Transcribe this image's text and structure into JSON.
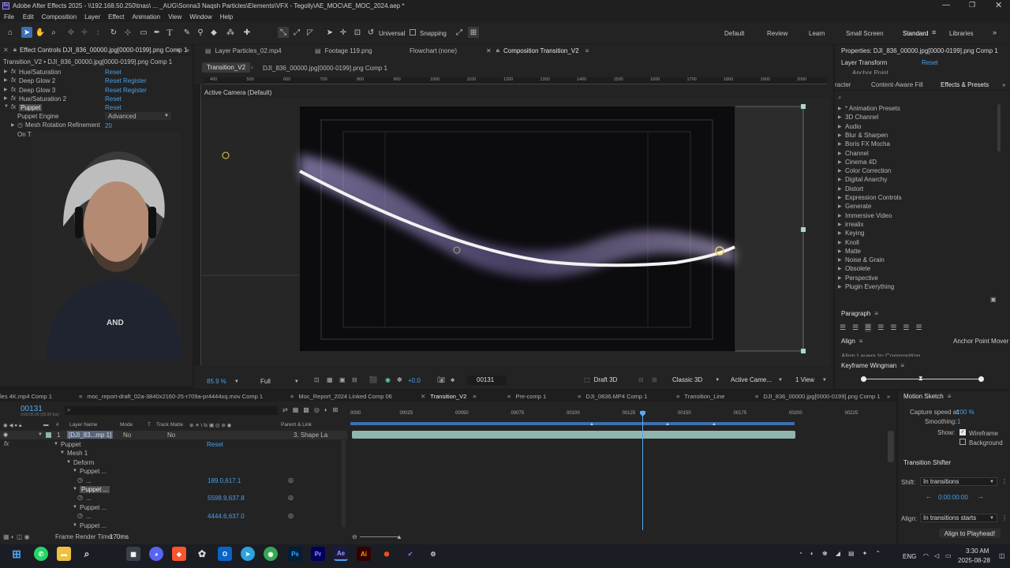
{
  "app": {
    "title": "Adobe After Effects 2025 - \\\\192.168.50.250\\tnas\\ ... _AUG\\Sonna3 Naqsh Particles\\Elements\\VFX - Tegolly\\AE_MOC\\AE_MOC_2024.aep *",
    "menu": [
      "File",
      "Edit",
      "Composition",
      "Layer",
      "Effect",
      "Animation",
      "View",
      "Window",
      "Help"
    ]
  },
  "toolbar": {
    "universal": "Universal",
    "snapping": "Snapping",
    "workspaces": [
      "Default",
      "Review",
      "Learn",
      "Small Screen",
      "Standard",
      "Libraries"
    ]
  },
  "effect_controls": {
    "tab": "Effect Controls DJI_836_00000.jpg[0000-0199].png Comp 1",
    "subtitle": "Transition_V2 • DJI_836_00000.jpg[0000-0199].png Comp 1",
    "effects": [
      {
        "name": "Hue/Saturation",
        "reset": "Reset",
        "register": ""
      },
      {
        "name": "Deep Glow 2",
        "reset": "Reset",
        "register": "Register"
      },
      {
        "name": "Deep Glow 3",
        "reset": "Reset",
        "register": "Register"
      },
      {
        "name": "Hue/Saturation 2",
        "reset": "Reset",
        "register": ""
      },
      {
        "name": "Puppet",
        "reset": "Reset",
        "register": ""
      }
    ],
    "puppet_engine_label": "Puppet Engine",
    "puppet_engine_value": "Advanced",
    "mesh_rotation_label": "Mesh Rotation Refinement",
    "mesh_rotation_value": "20",
    "on_transparent_label": "On Transparent"
  },
  "comp_panel": {
    "tabs": [
      "Layer Particles_02.mp4",
      "Footage 119.png",
      "Flowchart (none)",
      "Composition Transition_V2"
    ],
    "subtabs": [
      "Transition_V2",
      "DJI_836_00000.jpg[0000-0199].png Comp 1"
    ],
    "ruler": [
      "400",
      "500",
      "600",
      "700",
      "800",
      "900",
      "1000",
      "1100",
      "1200",
      "1300",
      "1400",
      "1500",
      "1600",
      "1700",
      "1800",
      "1900",
      "2000"
    ],
    "camera_label": "Active Camera (Default)",
    "zoom": "85.9 %",
    "resolution": "Full",
    "exposure": "+0.0",
    "timecode": "00131",
    "renderer_draft": "Draft 3D",
    "renderer": "Classic 3D",
    "camera_select": "Active Came...",
    "view_select": "1 View"
  },
  "properties": {
    "title": "Properties: DJI_836_00000.jpg[0000-0199].png Comp 1",
    "layer_transform": "Layer Transform",
    "reset": "Reset",
    "anchor": "Anchor Point"
  },
  "effects_presets": {
    "tabs": [
      "racter",
      "Content-Aware Fill",
      "Effects & Presets"
    ],
    "items": [
      "* Animation Presets",
      "3D Channel",
      "Audio",
      "Blur & Sharpen",
      "Boris FX Mocha",
      "Channel",
      "Cinema 4D",
      "Color Correction",
      "Digital Anarchy",
      "Distort",
      "Expression Controls",
      "Generate",
      "Immersive Video",
      "irrealix",
      "Keying",
      "Knoll",
      "Matte",
      "Noise & Grain",
      "Obsolete",
      "Perspective",
      "Plugin Everything"
    ]
  },
  "paragraph": {
    "title": "Paragraph"
  },
  "align": {
    "title": "Align",
    "anchor_mover": "Anchor Point Mover",
    "align_layers_to": "Align Layers to:",
    "composition": "Composition"
  },
  "keyframe_wingman": {
    "title": "Keyframe Wingman"
  },
  "motion_sketch": {
    "title": "Motion Sketch",
    "capture_label": "Capture speed at:",
    "capture_value": "100 %",
    "smoothing_label": "Smoothing:",
    "smoothing_value": "1",
    "show_label": "Show:",
    "wireframe": "Wireframe",
    "background": "Background"
  },
  "transition_shifter": {
    "title": "Transition Shifter",
    "shift_label": "Shift:",
    "shift_value": "In transitions",
    "time_value": "0:00:00:00",
    "align_label": "Align:",
    "align_value": "In transitions starts",
    "playhead_button": "Align to Playhead!"
  },
  "timeline": {
    "tabs": [
      "les 4K.mp4 Comp 1",
      "moc_report-draft_02a-3840x2160-25-r709a-pr4444xq.mov Comp 1",
      "Moc_Report_2024 Linked Comp 06",
      "Transition_V2",
      "Pre-comp 1",
      "DJI_0836.MP4 Comp 1",
      "Transition_Line",
      "DJI_836_00000.jpg[0000-0199].png Comp 1"
    ],
    "timecode": "00131",
    "timecode_sub": "0:00:05:06 (25.00 fps)",
    "col_headers": {
      "layer_name": "Layer Name",
      "mode": "Mode",
      "t": "T",
      "track_matte": "Track Matte",
      "parent": "Parent & Link"
    },
    "layer": {
      "num": "1",
      "name": "[DJI_83...mp 1]",
      "mode": "No",
      "matte": "No",
      "parent": "3. Shape La"
    },
    "rows": [
      {
        "label": "Puppet",
        "value": "Reset",
        "indent": 1
      },
      {
        "label": "Mesh 1",
        "value": "",
        "indent": 2
      },
      {
        "label": "Deform",
        "value": "",
        "indent": 3
      },
      {
        "label": "Puppet ...",
        "value": "",
        "indent": 4
      },
      {
        "label": "...",
        "value": "189.0,617.1",
        "indent": 5
      },
      {
        "label": "Puppet ...",
        "value": "",
        "indent": 4
      },
      {
        "label": "...",
        "value": "5598.9,637.8",
        "indent": 5
      },
      {
        "label": "Puppet ...",
        "value": "",
        "indent": 4
      },
      {
        "label": "...",
        "value": "4444.6,637.0",
        "indent": 5
      },
      {
        "label": "Puppet ...",
        "value": "",
        "indent": 4
      }
    ],
    "ruler": [
      "0000",
      "00025",
      "00050",
      "00075",
      "00100",
      "00125",
      "00150",
      "00175",
      "00200",
      "00225"
    ],
    "frame_render": "Frame Render Time:",
    "frame_render_value": "170ms"
  },
  "taskbar": {
    "lang": "ENG",
    "time": "3:30 AM",
    "date": "2025-08-28"
  }
}
